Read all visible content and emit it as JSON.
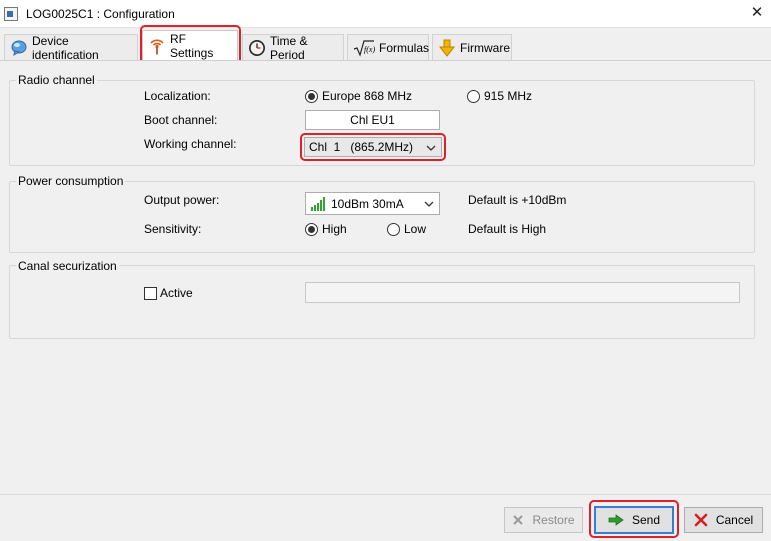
{
  "window": {
    "title": "LOG0025C1 : Configuration"
  },
  "tabs": [
    {
      "label": "Device identification",
      "icon": "bubble-icon"
    },
    {
      "label": "RF Settings",
      "icon": "antenna-icon",
      "active": true
    },
    {
      "label": "Time & Period",
      "icon": "clock-icon"
    },
    {
      "label": "Formulas",
      "icon": "sqrt-formula-icon"
    },
    {
      "label": "Firmware",
      "icon": "download-arrow-icon"
    }
  ],
  "radio_channel": {
    "group_label": "Radio channel",
    "localization_label": "Localization:",
    "options": [
      {
        "label": "Europe 868 MHz",
        "selected": true
      },
      {
        "label": "915 MHz",
        "selected": false
      }
    ],
    "boot_channel_label": "Boot channel:",
    "boot_channel_value": "Chl EU1",
    "working_channel_label": "Working channel:",
    "working_channel_value": "Chl  1   (865.2MHz)"
  },
  "power_consumption": {
    "group_label": "Power consumption",
    "output_power_label": "Output power:",
    "output_power_value": "10dBm 30mA",
    "output_power_default": "Default is +10dBm",
    "sensitivity_label": "Sensitivity:",
    "sensitivity_options": [
      {
        "label": "High",
        "selected": true
      },
      {
        "label": "Low",
        "selected": false
      }
    ],
    "sensitivity_default": "Default is High"
  },
  "canal_securization": {
    "group_label": "Canal securization",
    "active_label": "Active",
    "active_checked": false,
    "key_value": ""
  },
  "buttons": {
    "restore": "Restore",
    "send": "Send",
    "cancel": "Cancel"
  },
  "colors": {
    "highlight": "#e0202a",
    "send_arrow": "#2e9d2e",
    "cancel_x": "#d42020",
    "signal_bars": "#2fa52f"
  }
}
